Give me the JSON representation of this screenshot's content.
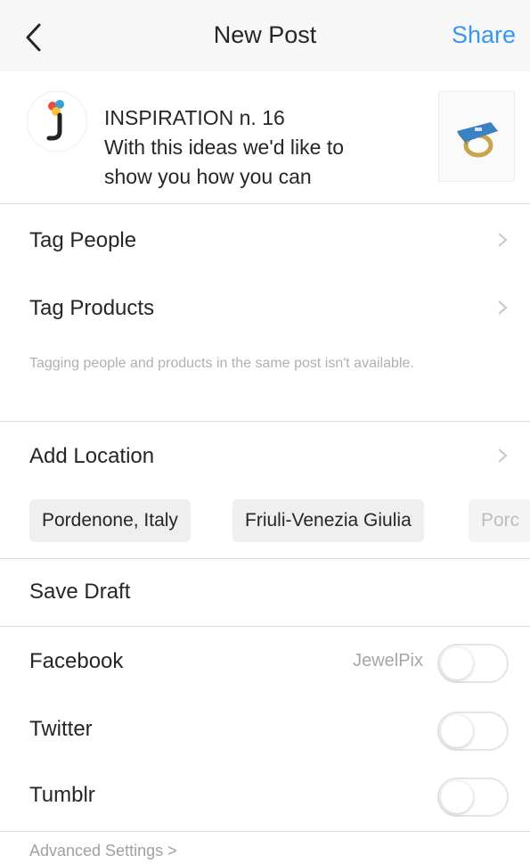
{
  "nav": {
    "back_icon": "chevron-left-icon",
    "title": "New Post",
    "share_label": "Share",
    "share_color": "#3897f0"
  },
  "post": {
    "avatar_icon": "jewelpix-logo",
    "caption_lines": [
      "INSPIRATION n. 16",
      "With this ideas we'd like to",
      "show you how you can"
    ],
    "thumbnail_icon": "ring-thumbnail"
  },
  "tag_people": {
    "label": "Tag People"
  },
  "tag_products": {
    "label": "Tag Products"
  },
  "tag_helper": {
    "text": "Tagging people and products in the same post isn't available."
  },
  "location": {
    "label": "Add Location",
    "suggestions": [
      "Pordenone, Italy",
      "Friuli-Venezia Giulia",
      "Porc"
    ]
  },
  "save_draft": {
    "label": "Save Draft"
  },
  "share_targets": [
    {
      "label": "Facebook",
      "account": "JewelPix",
      "enabled": false
    },
    {
      "label": "Twitter",
      "account": "",
      "enabled": false
    },
    {
      "label": "Tumblr",
      "account": "",
      "enabled": false
    }
  ],
  "advanced": {
    "label": "Advanced Settings >"
  }
}
